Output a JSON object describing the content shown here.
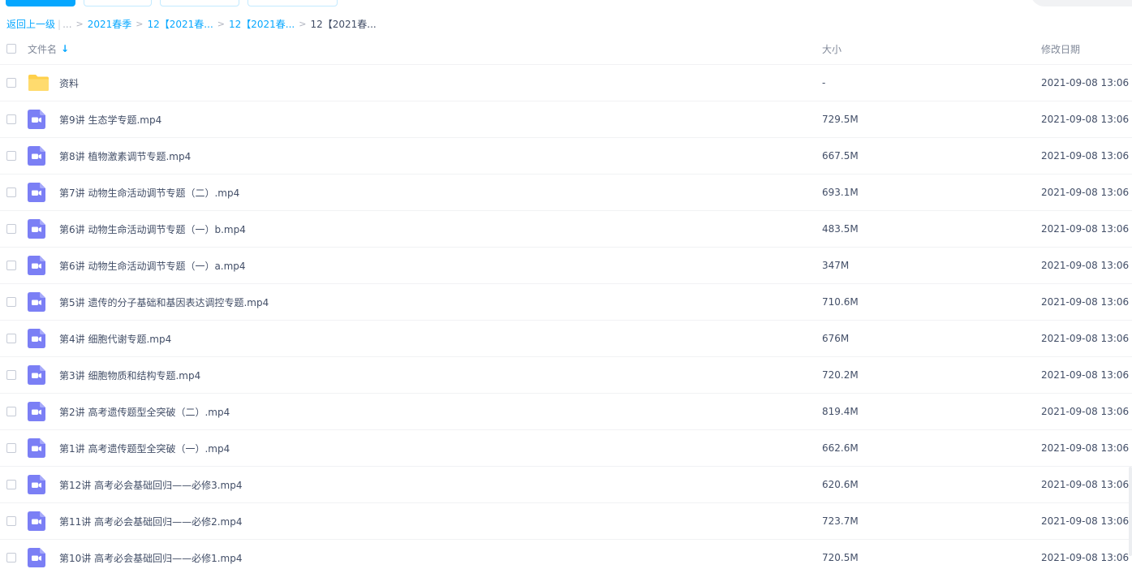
{
  "breadcrumb": {
    "back": "返回上一级",
    "pipe": "|",
    "ellipsis": "...",
    "sep": ">",
    "items": [
      "2021春季",
      "12【2021春...",
      "12【2021春..."
    ],
    "current": "12【2021春..."
  },
  "table": {
    "headers": {
      "name": "文件名",
      "sort_icon": "arrow-down-icon",
      "size": "大小",
      "date": "修改日期"
    },
    "rows": [
      {
        "icon": "folder-icon",
        "name": "资料",
        "size": "-",
        "date": "2021-09-08 13:06"
      },
      {
        "icon": "video-icon",
        "name": "第9讲 生态学专题.mp4",
        "size": "729.5M",
        "date": "2021-09-08 13:06"
      },
      {
        "icon": "video-icon",
        "name": "第8讲 植物激素调节专题.mp4",
        "size": "667.5M",
        "date": "2021-09-08 13:06"
      },
      {
        "icon": "video-icon",
        "name": "第7讲 动物生命活动调节专题（二）.mp4",
        "size": "693.1M",
        "date": "2021-09-08 13:06"
      },
      {
        "icon": "video-icon",
        "name": "第6讲 动物生命活动调节专题（一）b.mp4",
        "size": "483.5M",
        "date": "2021-09-08 13:06"
      },
      {
        "icon": "video-icon",
        "name": "第6讲 动物生命活动调节专题（一）a.mp4",
        "size": "347M",
        "date": "2021-09-08 13:06"
      },
      {
        "icon": "video-icon",
        "name": "第5讲 遗传的分子基础和基因表达调控专题.mp4",
        "size": "710.6M",
        "date": "2021-09-08 13:06"
      },
      {
        "icon": "video-icon",
        "name": "第4讲 细胞代谢专题.mp4",
        "size": "676M",
        "date": "2021-09-08 13:06"
      },
      {
        "icon": "video-icon",
        "name": "第3讲 细胞物质和结构专题.mp4",
        "size": "720.2M",
        "date": "2021-09-08 13:06"
      },
      {
        "icon": "video-icon",
        "name": "第2讲 高考遗传题型全突破（二）.mp4",
        "size": "819.4M",
        "date": "2021-09-08 13:06"
      },
      {
        "icon": "video-icon",
        "name": "第1讲 高考遗传题型全突破（一）.mp4",
        "size": "662.6M",
        "date": "2021-09-08 13:06"
      },
      {
        "icon": "video-icon",
        "name": "第12讲 高考必会基础回归——必修3.mp4",
        "size": "620.6M",
        "date": "2021-09-08 13:06"
      },
      {
        "icon": "video-icon",
        "name": "第11讲 高考必会基础回归——必修2.mp4",
        "size": "723.7M",
        "date": "2021-09-08 13:06"
      },
      {
        "icon": "video-icon",
        "name": "第10讲 高考必会基础回归——必修1.mp4",
        "size": "720.5M",
        "date": "2021-09-08 13:06"
      }
    ]
  },
  "colors": {
    "accent": "#06a7ff",
    "folder": "#ffd04b",
    "video": "#7b7ff5",
    "text": "#424e67",
    "muted": "#818999"
  }
}
